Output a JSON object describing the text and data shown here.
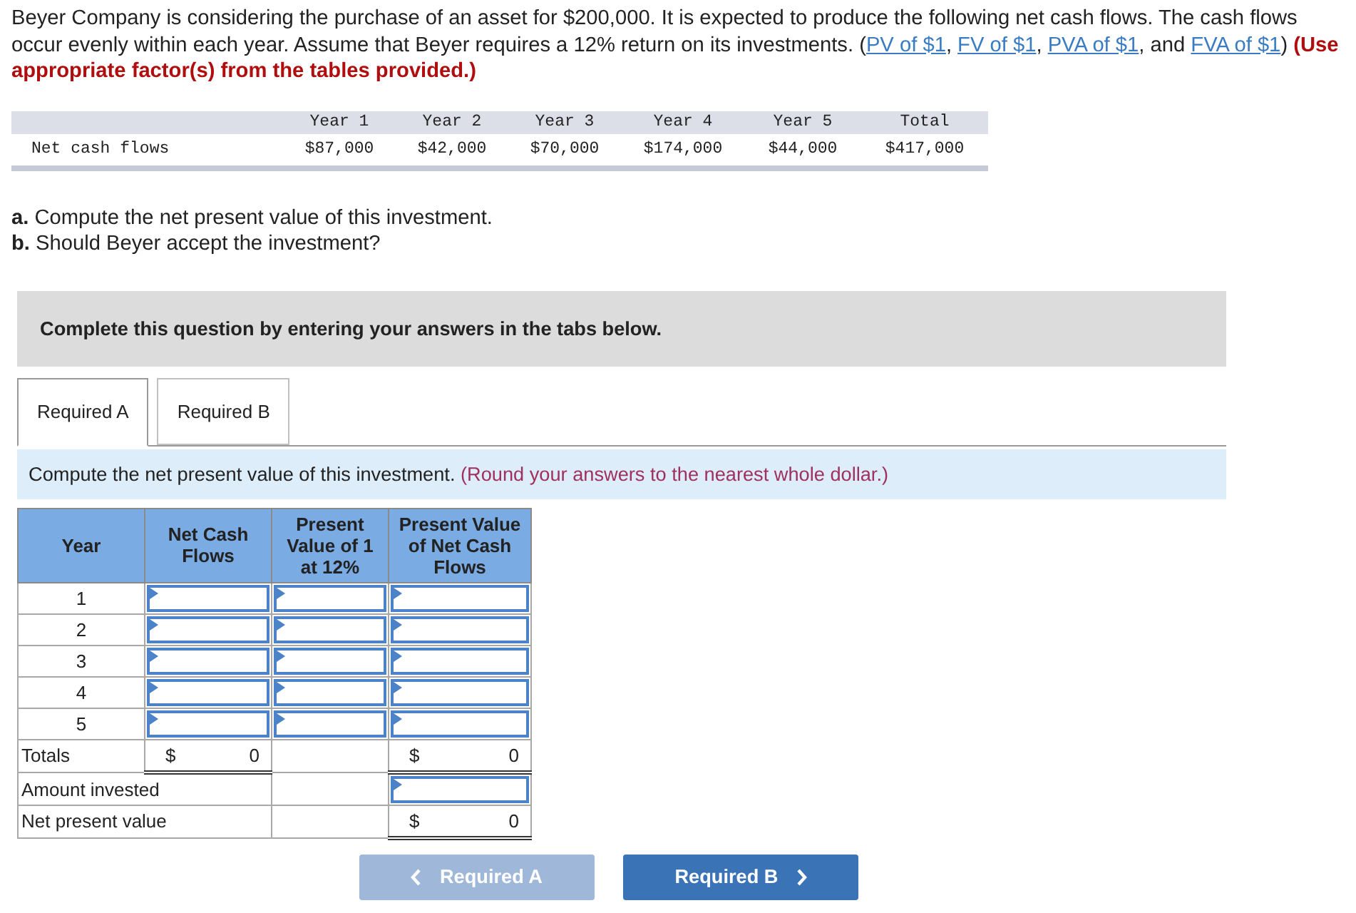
{
  "intro": {
    "parts": [
      {
        "kind": "text",
        "text": "Beyer Company is considering the purchase of an asset for $200,000. It is expected to produce the following net cash flows. The cash flows occur evenly within each year. Assume that Beyer requires a 12% return on its investments. ("
      },
      {
        "kind": "link",
        "text": "PV of $1"
      },
      {
        "kind": "text",
        "text": ", "
      },
      {
        "kind": "link",
        "text": "FV of $1"
      },
      {
        "kind": "text",
        "text": ", "
      },
      {
        "kind": "link",
        "text": "PVA of $1"
      },
      {
        "kind": "text",
        "text": ", and "
      },
      {
        "kind": "link",
        "text": "FVA of $1"
      },
      {
        "kind": "text",
        "text": ") "
      },
      {
        "kind": "emphasis",
        "text": "(Use appropriate factor(s) from the tables provided.)"
      }
    ]
  },
  "cash_flows": {
    "columns": [
      "Year 1",
      "Year 2",
      "Year 3",
      "Year 4",
      "Year 5",
      "Total"
    ],
    "row": {
      "label": "Net cash flows",
      "values": [
        "$87,000",
        "$42,000",
        "$70,000",
        "$174,000",
        "$44,000",
        "$417,000"
      ]
    }
  },
  "questions": [
    "**a.** Compute the net present value of this investment.",
    "**b.** Should Beyer accept the investment?"
  ],
  "banner": "Complete this question by entering your answers in the tabs below.",
  "tabs": [
    {
      "label": "Required A",
      "selected": true
    },
    {
      "label": "Required B",
      "selected": false
    }
  ],
  "prompt": {
    "text": "Compute the net present value of this investment.",
    "hint": "(Round your answers to the nearest whole dollar.)"
  },
  "worksheet": {
    "columns": [
      "Year",
      "Net Cash Flows",
      "Present Value of 1 at 12%",
      "Present Value of Net Cash Flows"
    ],
    "rows": [
      {
        "kind": "year",
        "label": "1"
      },
      {
        "kind": "year",
        "label": "2"
      },
      {
        "kind": "year",
        "label": "3"
      },
      {
        "kind": "year",
        "label": "4"
      },
      {
        "kind": "year",
        "label": "5"
      },
      {
        "kind": "totals",
        "label": "Totals",
        "net_cash": {
          "currency": "$",
          "value": "0"
        },
        "present_value": {
          "currency": "$",
          "value": "0"
        }
      },
      {
        "kind": "input",
        "label": "Amount invested"
      },
      {
        "kind": "result",
        "label": "Net present value",
        "present_value": {
          "currency": "$",
          "value": "0"
        }
      }
    ]
  },
  "nav": [
    {
      "label": "Required A",
      "kind": "previous",
      "disabled": true
    },
    {
      "label": "Required B",
      "kind": "next",
      "disabled": false
    }
  ]
}
